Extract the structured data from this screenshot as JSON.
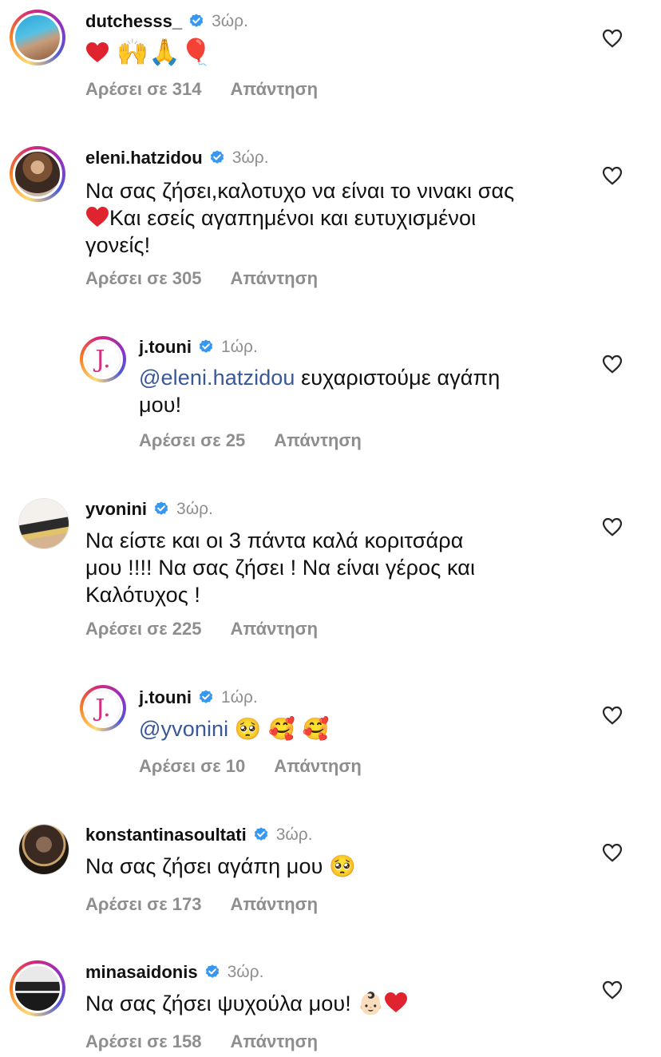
{
  "comments": [
    {
      "username": "dutchesss_",
      "time": "3ώρ.",
      "text": "",
      "likes": "Αρέσει σε 314",
      "reply_label": "Απάντηση"
    },
    {
      "username": "eleni.hatzidou",
      "time": "3ώρ.",
      "text_line1": "Να σας ζήσει,καλοτυχο να είναι το νινακι σας",
      "text_line2": "Και εσείς αγαπημένοι και ευτυχισμένοι",
      "text_line3": "γονείς!",
      "likes": "Αρέσει σε 305",
      "reply_label": "Απάντηση"
    },
    {
      "username": "j.touni",
      "time": "1ώρ.",
      "mention": "@eleni.hatzidou",
      "text_line1": " ευχαριστούμε αγάπη",
      "text_line2": "μου!",
      "likes": "Αρέσει σε 25",
      "reply_label": "Απάντηση",
      "avatar_letter": "J."
    },
    {
      "username": "yvonini",
      "time": "3ώρ.",
      "text_line1": "Να είστε και οι 3 πάντα καλά κοριτσάρα",
      "text_line2": "μου !!!! Να σας ζήσει ! Να είναι γέρος και",
      "text_line3": "Καλότυχος !",
      "likes": "Αρέσει σε 225",
      "reply_label": "Απάντηση"
    },
    {
      "username": "j.touni",
      "time": "1ώρ.",
      "mention": "@yvonini",
      "text_emoji": "🥺 🥰 🥰",
      "likes": "Αρέσει σε 10",
      "reply_label": "Απάντηση",
      "avatar_letter": "J."
    },
    {
      "username": "konstantinasoultati",
      "time": "3ώρ.",
      "text_line1": "Να σας ζήσει αγάπη μου",
      "text_emoji": "🥺",
      "likes": "Αρέσει σε 173",
      "reply_label": "Απάντηση"
    },
    {
      "username": "minasaidonis",
      "time": "3ώρ.",
      "text_line1": "Να σας ζήσει ψυχούλα μου!",
      "text_emoji": "👶🏻",
      "likes": "Αρέσει σε 158",
      "reply_label": "Απάντηση"
    }
  ],
  "colors": {
    "mention": "#385898",
    "meta": "#8e8e8e",
    "verified": "#3897f0",
    "heart_emoji": "#e0242f"
  },
  "icons": {
    "like": "heart-outline-icon",
    "verified": "verified-badge-icon"
  }
}
